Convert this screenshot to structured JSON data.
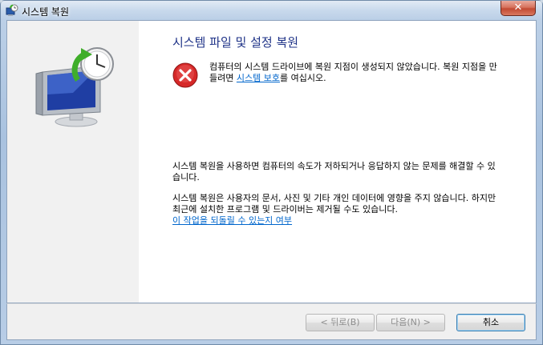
{
  "window": {
    "title": "시스템 복원",
    "close_label": "✕"
  },
  "main": {
    "heading": "시스템 파일 및 설정 복원",
    "error_prefix": "컴퓨터의 시스템 드라이브에 복원 지점이 생성되지 않았습니다. 복원 지점을 만들려면 ",
    "error_link": "시스템 보호",
    "error_suffix": "를 여십시오.",
    "para1": "시스템 복원을 사용하면 컴퓨터의 속도가 저하되거나 응답하지 않는 문제를 해결할 수 있습니다.",
    "para2": "시스템 복원은 사용자의 문서, 사진 및 기타 개인 데이터에 영향을 주지 않습니다. 하지만 최근에 설치한 프로그램 및 드라이버는 제거될 수도 있습니다.",
    "para2_link": "이 작업을 되돌릴 수 있는지 여부"
  },
  "footer": {
    "back_label": "< 뒤로(B)",
    "next_label": "다음(N) >",
    "cancel_label": "취소"
  },
  "icons": {
    "title_icon": "system-restore-icon",
    "hero": "computer-clock-restore-icon",
    "error": "error-icon"
  },
  "colors": {
    "heading": "#1e3287",
    "link": "#0066cc",
    "error": "#d62828",
    "restore_arrow": "#3fae2a"
  }
}
